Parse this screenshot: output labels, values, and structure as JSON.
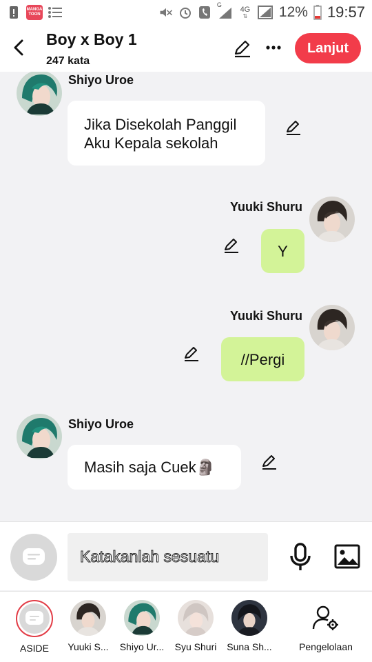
{
  "status_bar": {
    "battery_percent": "12%",
    "time": "19:57",
    "network_label": "4G",
    "signal_label": "G",
    "app_badge": "MANGA TOON"
  },
  "header": {
    "title": "Boy x Boy 1",
    "word_count": "247 kata",
    "next_label": "Lanjut"
  },
  "messages": [
    {
      "sender": "Shiyo Uroe",
      "side": "left",
      "text": "Jika Disekolah Panggil\nAku Kepala sekolah"
    },
    {
      "sender": "Yuuki Shuru",
      "side": "right",
      "text": "Y"
    },
    {
      "sender": "Yuuki Shuru",
      "side": "right",
      "text": "//Pergi"
    },
    {
      "sender": "Shiyo Uroe",
      "side": "left",
      "text": "Masih saja Cuek🗿"
    }
  ],
  "composer": {
    "placeholder": "Katakanlah sesuatu"
  },
  "characters": [
    {
      "label": "ASIDE"
    },
    {
      "label": "Yuuki S..."
    },
    {
      "label": "Shiyo Ur..."
    },
    {
      "label": "Syu Shuri"
    },
    {
      "label": "Suna Sh..."
    },
    {
      "label": "Pengelolaan"
    }
  ],
  "colors": {
    "accent_red": "#f23c4a",
    "bubble_green": "#d3f398",
    "chat_bg": "#f2f2f4"
  }
}
